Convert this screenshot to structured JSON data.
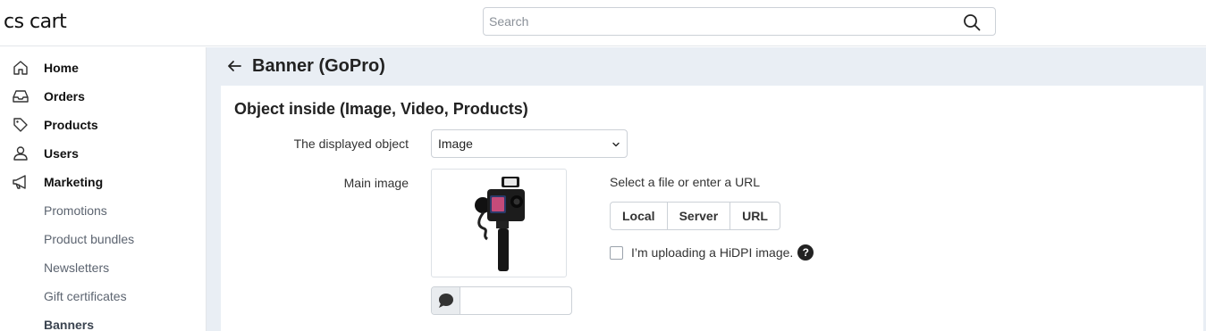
{
  "header": {
    "logo": "cs cart",
    "search": {
      "placeholder": "Search",
      "value": ""
    }
  },
  "sidebar": {
    "items": [
      {
        "label": "Home",
        "icon": "home-icon"
      },
      {
        "label": "Orders",
        "icon": "inbox-icon"
      },
      {
        "label": "Products",
        "icon": "tag-icon"
      },
      {
        "label": "Users",
        "icon": "user-icon"
      },
      {
        "label": "Marketing",
        "icon": "megaphone-icon"
      }
    ],
    "marketing_subitems": [
      "Promotions",
      "Product bundles",
      "Newsletters",
      "Gift certificates",
      "Banners"
    ]
  },
  "page": {
    "title": "Banner (GoPro)",
    "section_title": "Object inside (Image, Video, Products)",
    "displayed_object": {
      "label": "The displayed object",
      "value": "Image"
    },
    "main_image": {
      "label": "Main image",
      "upload_hint": "Select a file or enter a URL",
      "source_buttons": [
        "Local",
        "Server",
        "URL"
      ],
      "hidpi_label": "I’m uploading a HiDPI image.",
      "hidpi_checked": false,
      "help_glyph": "?",
      "alt_value": ""
    }
  },
  "colors": {
    "main_bg": "#e9eef4",
    "card_bg": "#ffffff",
    "text": "#222222",
    "sub_text": "#5c6470"
  }
}
